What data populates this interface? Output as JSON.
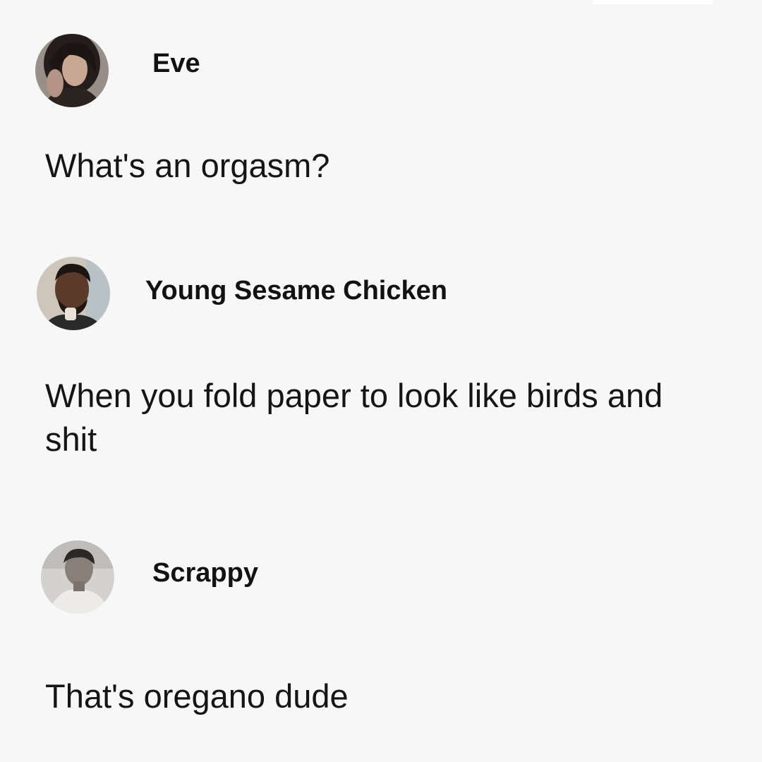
{
  "comments": [
    {
      "author": "Eve",
      "avatar_icon": "profile-photo-dark-hair-woman",
      "text": "What's an orgasm?"
    },
    {
      "author": "Young Sesame Chicken",
      "avatar_icon": "profile-photo-man",
      "text": "When you fold paper to look like birds and shit"
    },
    {
      "author": "Scrappy",
      "avatar_icon": "profile-photo-black-and-white-portrait",
      "text": "That's oregano dude"
    }
  ],
  "colors": {
    "background": "#f7f7f7",
    "text": "#111111"
  }
}
